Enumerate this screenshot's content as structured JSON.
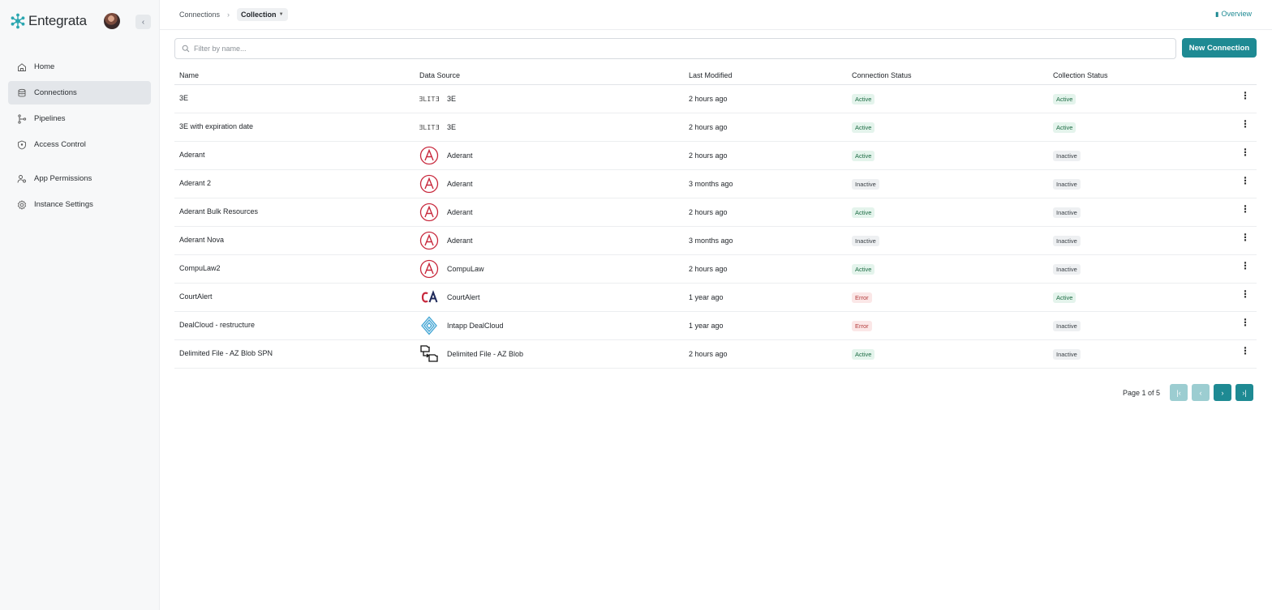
{
  "brand": {
    "name": "Entegrata"
  },
  "sidebar": {
    "items": [
      {
        "label": "Home",
        "icon": "home-icon"
      },
      {
        "label": "Connections",
        "icon": "database-icon",
        "active": true
      },
      {
        "label": "Pipelines",
        "icon": "pipeline-icon"
      },
      {
        "label": "Access Control",
        "icon": "shield-icon"
      },
      {
        "label": "App Permissions",
        "icon": "user-key-icon"
      },
      {
        "label": "Instance Settings",
        "icon": "gear-icon"
      }
    ]
  },
  "header": {
    "breadcrumb": [
      "Connections",
      "Collection"
    ],
    "overview_label": "Overview"
  },
  "toolbar": {
    "filter_placeholder": "Filter by name...",
    "new_button_label": "New Connection"
  },
  "table": {
    "columns": [
      "Name",
      "Data Source",
      "Last Modified",
      "Connection Status",
      "Collection Status"
    ],
    "rows": [
      {
        "name": "3E",
        "source": "3E",
        "logo": "elite-logo",
        "modified": "2 hours ago",
        "conn": "Active",
        "coll": "Active"
      },
      {
        "name": "3E with expiration date",
        "source": "3E",
        "logo": "elite-logo",
        "modified": "2 hours ago",
        "conn": "Active",
        "coll": "Active"
      },
      {
        "name": "Aderant",
        "source": "Aderant",
        "logo": "aderant-logo",
        "modified": "2 hours ago",
        "conn": "Active",
        "coll": "Inactive"
      },
      {
        "name": "Aderant 2",
        "source": "Aderant",
        "logo": "aderant-logo",
        "modified": "3 months ago",
        "conn": "Inactive",
        "coll": "Inactive"
      },
      {
        "name": "Aderant Bulk Resources",
        "source": "Aderant",
        "logo": "aderant-logo",
        "modified": "2 hours ago",
        "conn": "Active",
        "coll": "Inactive"
      },
      {
        "name": "Aderant Nova",
        "source": "Aderant",
        "logo": "aderant-logo",
        "modified": "3 months ago",
        "conn": "Inactive",
        "coll": "Inactive"
      },
      {
        "name": "CompuLaw2",
        "source": "CompuLaw",
        "logo": "aderant-logo",
        "modified": "2 hours ago",
        "conn": "Active",
        "coll": "Inactive"
      },
      {
        "name": "CourtAlert",
        "source": "CourtAlert",
        "logo": "courtalert-logo",
        "modified": "1 year ago",
        "conn": "Error",
        "coll": "Active"
      },
      {
        "name": "DealCloud - restructure",
        "source": "Intapp DealCloud",
        "logo": "dealcloud-logo",
        "modified": "1 year ago",
        "conn": "Error",
        "coll": "Inactive"
      },
      {
        "name": "Delimited File - AZ Blob SPN",
        "source": "Delimited File - AZ Blob",
        "logo": "file-transfer-logo",
        "modified": "2 hours ago",
        "conn": "Active",
        "coll": "Inactive"
      }
    ]
  },
  "pagination": {
    "label": "Page 1 of 5"
  },
  "colors": {
    "accent": "#1e8a93",
    "active_bg": "#e4f4ec",
    "error_bg": "#fbe7e7"
  }
}
